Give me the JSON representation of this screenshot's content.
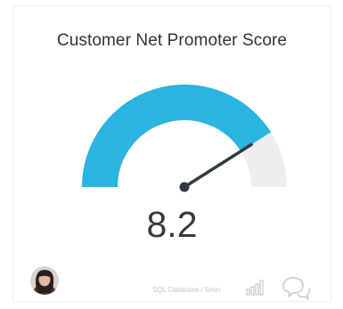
{
  "card": {
    "title": "Customer Net Promoter Score",
    "value_label": "8.2",
    "gauge": {
      "value": 8.2,
      "min": 0,
      "max": 10,
      "fill_color": "#2ab4e2",
      "track_color": "#eeeeee",
      "needle_color": "#2f3a44"
    },
    "footer": {
      "source_label": "SQL Database / 5min",
      "icons": [
        "avatar",
        "bar-chart-icon",
        "comments-icon"
      ]
    }
  }
}
